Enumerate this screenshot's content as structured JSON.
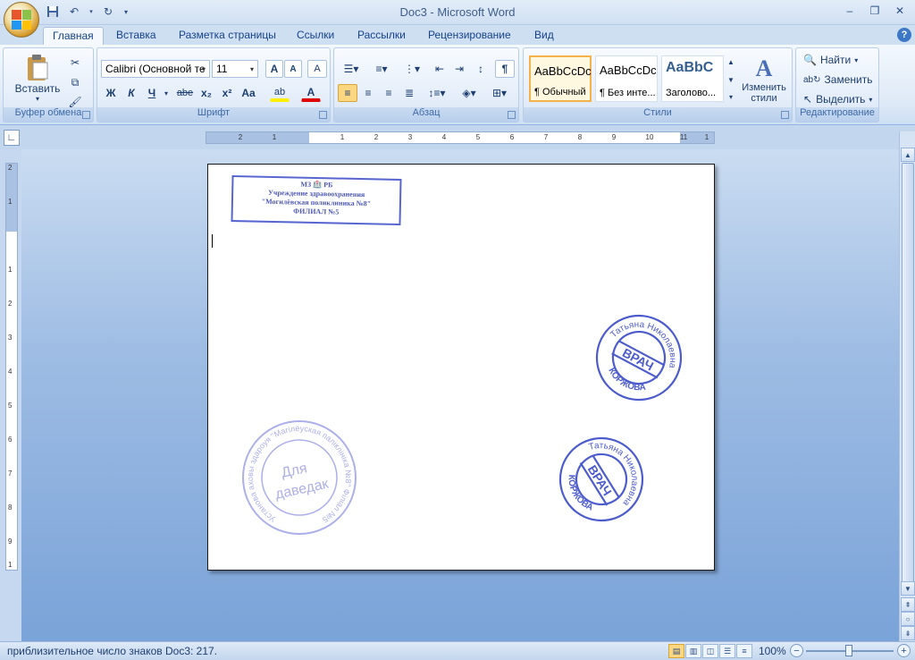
{
  "window": {
    "title": "Doc3 - Microsoft Word",
    "controls": [
      "minimize",
      "restore",
      "close"
    ]
  },
  "quick_access": {
    "items": [
      {
        "name": "save-icon"
      },
      {
        "name": "undo-icon"
      },
      {
        "name": "redo-icon"
      },
      {
        "name": "customize-qat-icon"
      }
    ]
  },
  "ribbon_tabs": [
    "Главная",
    "Вставка",
    "Разметка страницы",
    "Ссылки",
    "Рассылки",
    "Рецензирование",
    "Вид"
  ],
  "ribbon_active_tab": "Главная",
  "clipboard": {
    "paste_label": "Вставить",
    "group_label": "Буфер обмена"
  },
  "font": {
    "family": "Calibri (Основной те",
    "size": "11",
    "group_label": "Шрифт",
    "buttons": {
      "grow": "A",
      "shrink": "A",
      "clear": "A",
      "bold": "Ж",
      "italic": "К",
      "underline": "Ч",
      "strike": "abe",
      "subscript": "x₂",
      "superscript": "x²",
      "case": "Aa",
      "highlight": "ab",
      "color": "A"
    }
  },
  "paragraph": {
    "group_label": "Абзац",
    "pilcrow": "¶"
  },
  "styles": {
    "group_label": "Стили",
    "tiles": [
      {
        "sample": "AaBbCcDc",
        "name": "¶ Обычный",
        "active": true
      },
      {
        "sample": "AaBbCcDc",
        "name": "¶ Без инте...",
        "active": false
      },
      {
        "sample": "AaBbC",
        "name": "Заголово...",
        "active": false
      }
    ],
    "change_styles_line1": "Изменить",
    "change_styles_line2": "стили"
  },
  "editing": {
    "group_label": "Редактирование",
    "find": "Найти",
    "replace": "Заменить",
    "select": "Выделить"
  },
  "ruler": {
    "h_numbers": [
      "2",
      "1",
      "1",
      "1",
      "2",
      "3",
      "4",
      "5",
      "6",
      "7",
      "8",
      "9",
      "10",
      "11",
      "1"
    ],
    "v_numbers": [
      "2",
      "1",
      "1",
      "1",
      "2",
      "3",
      "4",
      "5",
      "6",
      "7",
      "8",
      "9",
      "1"
    ]
  },
  "document": {
    "rect_stamp": {
      "line1": "МЗ 🏥 РБ",
      "line2": "Учреждение здравоохранения",
      "line3": "\"Могилёвская поликлиника №8\"",
      "line4": "ФИЛИАЛ №5"
    },
    "stamp_doctor_1": {
      "outer_top": "Татьяна Николаевна",
      "outer_bottom": "КОРЖОВА",
      "center": "ВРАЧ"
    },
    "stamp_doctor_2": {
      "outer_top": "Татьяна Николаевна",
      "outer_bottom": "КОРЖОВА",
      "center": "ВРАЧ"
    },
    "stamp_round": {
      "outer": "Установа аховы здароуя \"Магілёуская паліклініка №8\" Філіал №5",
      "center_line1": "Для",
      "center_line2": "даведак"
    }
  },
  "status": {
    "text": "приблизительное число знаков Doc3: 217.",
    "zoom": "100%"
  },
  "colors": {
    "stamp_ink": "#3a4bc8",
    "ribbon_bg": "#dfeaf7",
    "doc_bg": "#7aa3d8"
  }
}
